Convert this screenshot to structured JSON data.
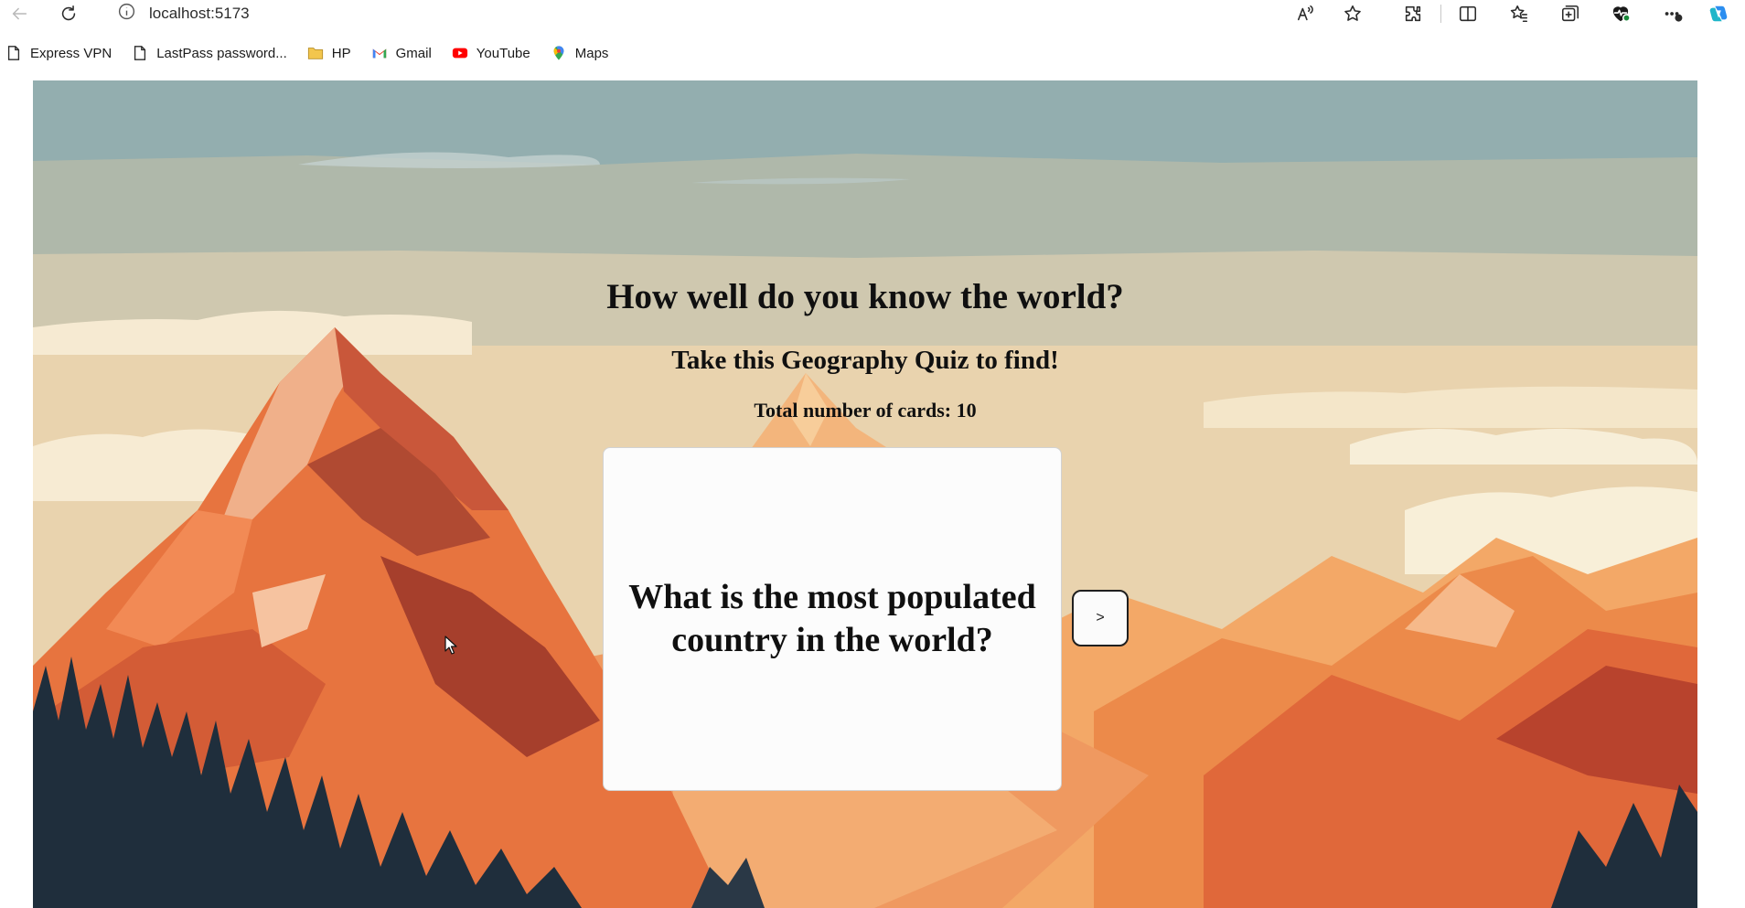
{
  "browser": {
    "url": "localhost:5173",
    "icons": [
      "back-icon",
      "refresh-icon",
      "site-info-icon",
      "read-aloud-icon",
      "favorite-star-icon",
      "extensions-icon",
      "split-screen-icon",
      "favorites-icon",
      "collections-icon",
      "browser-essentials-icon",
      "more-icon",
      "copilot-icon"
    ],
    "bookmarks": [
      {
        "label": "Express VPN",
        "icon": "page-icon"
      },
      {
        "label": "LastPass password...",
        "icon": "page-icon"
      },
      {
        "label": "HP",
        "icon": "folder-icon"
      },
      {
        "label": "Gmail",
        "icon": "gmail-icon"
      },
      {
        "label": "YouTube",
        "icon": "youtube-icon"
      },
      {
        "label": "Maps",
        "icon": "maps-icon"
      }
    ]
  },
  "quiz": {
    "title": "How well do you know the world?",
    "subtitle": "Take this Geography Quiz to find!",
    "card_count_label": "Total number of cards:",
    "card_count": "10",
    "question": "What is the most populated country in the world?",
    "next_label": ">"
  },
  "colors": {
    "sky_top": "#93AEAF",
    "sky_mid": "#AFB8AA",
    "sky_warm": "#E8D2AE",
    "mountain_orange": "#E9743E",
    "forest_dark": "#1F2E3C",
    "card_bg": "#FCFCFC"
  }
}
